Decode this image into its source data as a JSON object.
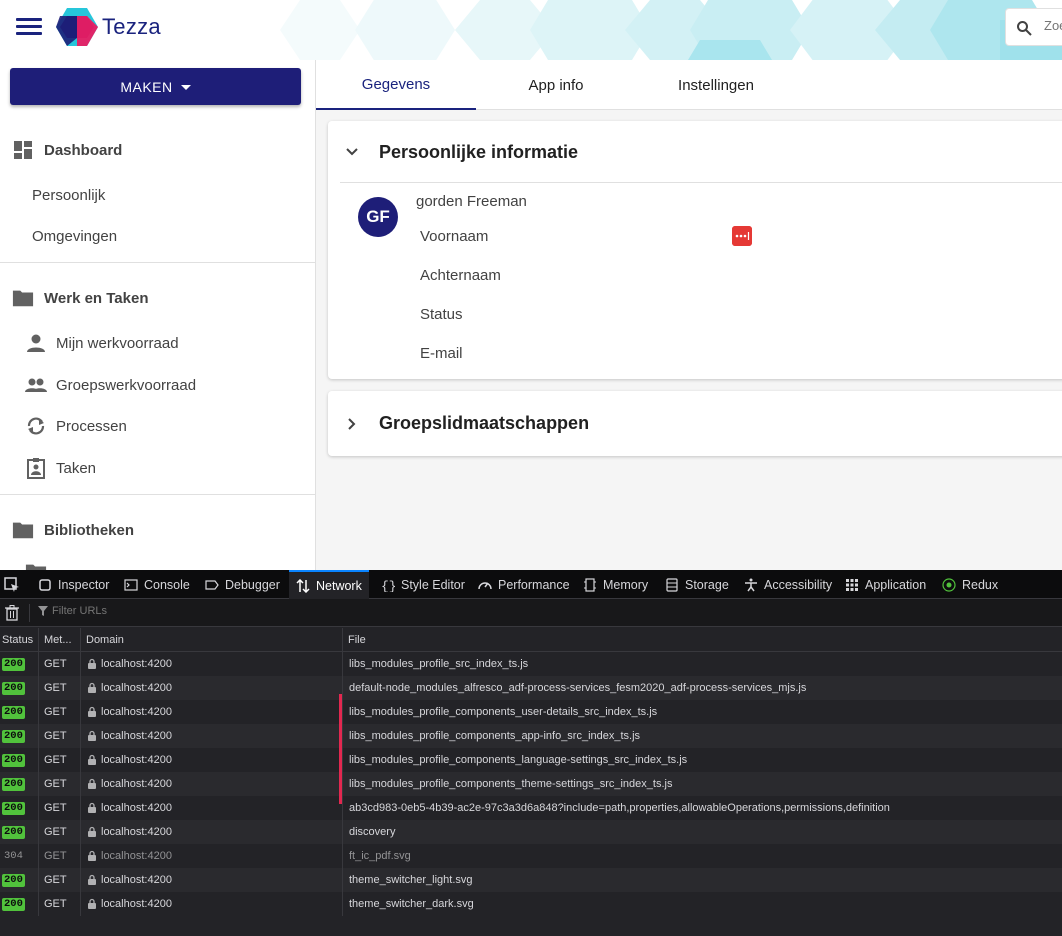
{
  "header": {
    "brand": "Tezza",
    "search_placeholder": "Zoeken"
  },
  "sidebar": {
    "create_label": "MAKEN",
    "sections": [
      {
        "label": "Dashboard",
        "icon": "dashboard-icon"
      },
      {
        "label": "Werk en Taken",
        "icon": "folder-icon"
      },
      {
        "label": "Bibliotheken",
        "icon": "folder-icon"
      }
    ],
    "dashboard_items": [
      "Persoonlijk",
      "Omgevingen"
    ],
    "work_items": [
      {
        "label": "Mijn werkvoorraad",
        "icon": "person-icon"
      },
      {
        "label": "Groepswerkvoorraad",
        "icon": "group-icon"
      },
      {
        "label": "Processen",
        "icon": "sync-icon"
      },
      {
        "label": "Taken",
        "icon": "assignment-icon"
      }
    ]
  },
  "tabs": [
    "Gegevens",
    "App info",
    "Instellingen"
  ],
  "personal_card": {
    "title": "Persoonlijke informatie",
    "initials": "GF",
    "name": "gorden Freeman",
    "fields": [
      "Voornaam",
      "Achternaam",
      "Status",
      "E-mail"
    ]
  },
  "groups_card": {
    "title": "Groepslidmaatschappen"
  },
  "devtools": {
    "tabs": [
      "Inspector",
      "Console",
      "Debugger",
      "Network",
      "Style Editor",
      "Performance",
      "Memory",
      "Storage",
      "Accessibility",
      "Application",
      "Redux"
    ],
    "filter_placeholder": "Filter URLs",
    "columns": [
      "Status",
      "Met...",
      "Domain",
      "File"
    ],
    "requests": [
      {
        "status": "200",
        "method": "GET",
        "domain": "localhost:4200",
        "file": "libs_modules_profile_src_index_ts.js"
      },
      {
        "status": "200",
        "method": "GET",
        "domain": "localhost:4200",
        "file": "default-node_modules_alfresco_adf-process-services_fesm2020_adf-process-services_mjs.js"
      },
      {
        "status": "200",
        "method": "GET",
        "domain": "localhost:4200",
        "file": "libs_modules_profile_components_user-details_src_index_ts.js"
      },
      {
        "status": "200",
        "method": "GET",
        "domain": "localhost:4200",
        "file": "libs_modules_profile_components_app-info_src_index_ts.js"
      },
      {
        "status": "200",
        "method": "GET",
        "domain": "localhost:4200",
        "file": "libs_modules_profile_components_language-settings_src_index_ts.js"
      },
      {
        "status": "200",
        "method": "GET",
        "domain": "localhost:4200",
        "file": "libs_modules_profile_components_theme-settings_src_index_ts.js"
      },
      {
        "status": "200",
        "method": "GET",
        "domain": "localhost:4200",
        "file": "ab3cd983-0eb5-4b39-ac2e-97c3a3d6a848?include=path,properties,allowableOperations,permissions,definition"
      },
      {
        "status": "200",
        "method": "GET",
        "domain": "localhost:4200",
        "file": "discovery"
      },
      {
        "status": "304",
        "method": "GET",
        "domain": "localhost:4200",
        "file": "ft_ic_pdf.svg"
      },
      {
        "status": "200",
        "method": "GET",
        "domain": "localhost:4200",
        "file": "theme_switcher_light.svg"
      },
      {
        "status": "200",
        "method": "GET",
        "domain": "localhost:4200",
        "file": "theme_switcher_dark.svg"
      }
    ]
  },
  "colors": {
    "primary": "#1e1e78",
    "accent": "#e91e63",
    "teal": "#26c6da",
    "status_ok": "#51c23c",
    "devtools_bg": "#232327",
    "highlight": "#e22850"
  }
}
